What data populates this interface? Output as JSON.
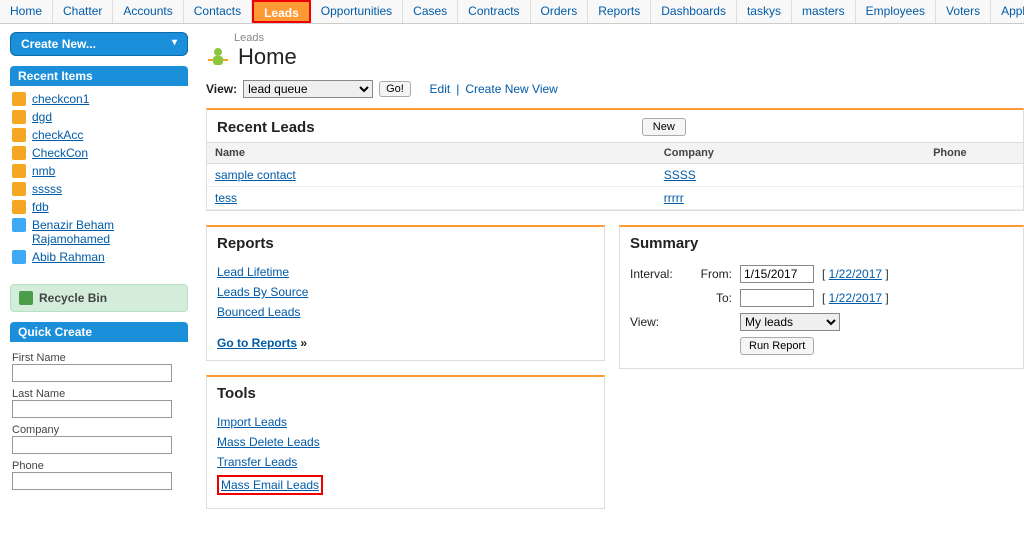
{
  "nav": [
    "Home",
    "Chatter",
    "Accounts",
    "Contacts",
    "Leads",
    "Opportunities",
    "Cases",
    "Contracts",
    "Orders",
    "Reports",
    "Dashboards",
    "taskys",
    "masters",
    "Employees",
    "Voters",
    "Applicant"
  ],
  "nav_active": 4,
  "create_new": "Create New...",
  "recent_items_hdr": "Recent Items",
  "recent_items": [
    {
      "label": "checkcon1",
      "icon": "orange"
    },
    {
      "label": "dgd",
      "icon": "orange"
    },
    {
      "label": "checkAcc",
      "icon": "orange"
    },
    {
      "label": "CheckCon",
      "icon": "orange"
    },
    {
      "label": "nmb",
      "icon": "orange"
    },
    {
      "label": "sssss",
      "icon": "orange"
    },
    {
      "label": "fdb",
      "icon": "orange"
    },
    {
      "label": "Benazir Beham Rajamohamed",
      "icon": "blue"
    },
    {
      "label": "Abib Rahman",
      "icon": "blue"
    }
  ],
  "recycle": "Recycle Bin",
  "quick_create_hdr": "Quick Create",
  "quick_create": [
    {
      "label": "First Name"
    },
    {
      "label": "Last Name"
    },
    {
      "label": "Company"
    },
    {
      "label": "Phone"
    }
  ],
  "breadcrumb": "Leads",
  "page_title": "Home",
  "view_label": "View:",
  "view_value": "lead queue",
  "go": "Go!",
  "edit": "Edit",
  "create_view": "Create New View",
  "recent_leads": {
    "title": "Recent Leads",
    "new": "New",
    "cols": [
      "Name",
      "Company",
      "Phone"
    ],
    "rows": [
      {
        "name": "sample contact",
        "company": "SSSS",
        "phone": ""
      },
      {
        "name": "tess",
        "company": "rrrrr",
        "phone": ""
      }
    ]
  },
  "reports": {
    "title": "Reports",
    "links": [
      "Lead Lifetime",
      "Leads By Source",
      "Bounced Leads"
    ],
    "goto": "Go to Reports"
  },
  "summary": {
    "title": "Summary",
    "interval": "Interval:",
    "from": "From:",
    "to": "To:",
    "from_val": "1/15/2017",
    "to_val": "",
    "date_link": "1/22/2017",
    "view": "View:",
    "view_val": "My leads",
    "run": "Run Report"
  },
  "tools": {
    "title": "Tools",
    "links": [
      "Import Leads",
      "Mass Delete Leads",
      "Transfer Leads",
      "Mass Email Leads"
    ]
  }
}
